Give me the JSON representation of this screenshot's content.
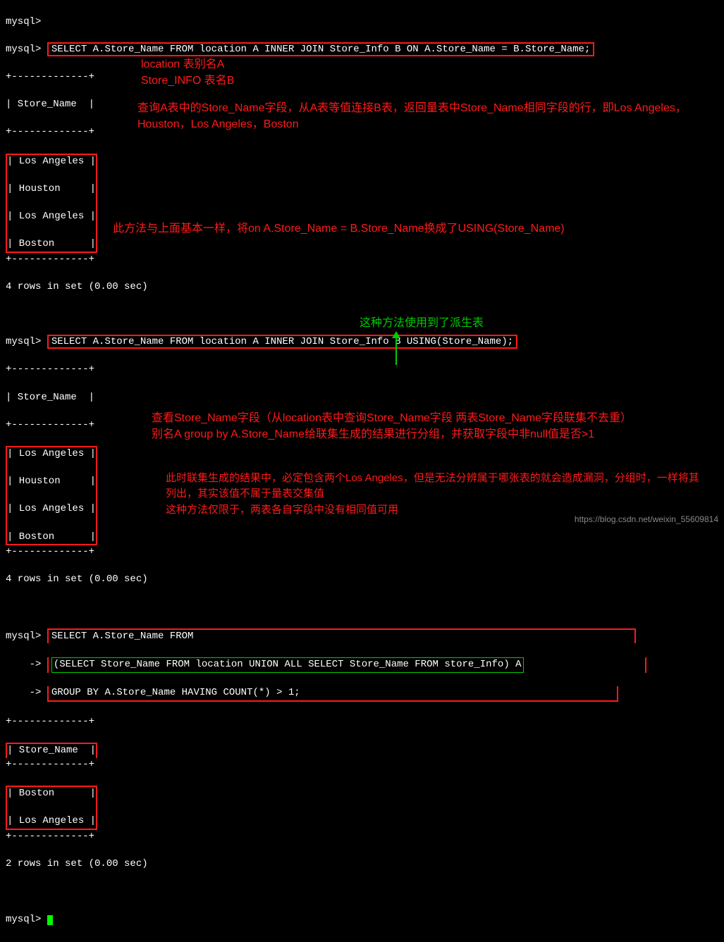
{
  "prompts": {
    "mysql": "mysql>",
    "cont": "    ->"
  },
  "queries": {
    "q1": "SELECT A.Store_Name FROM location A INNER JOIN Store_Info B ON A.Store_Name = B.Store_Name;",
    "q2": "SELECT A.Store_Name FROM location A INNER JOIN Store_Info B USING(Store_Name);",
    "q3a": "SELECT A.Store_Name FROM",
    "q3b": "(SELECT Store_Name FROM location UNION ALL SELECT Store_Name FROM store_Info) A",
    "q3c": "GROUP BY A.Store_Name HAVING COUNT(*) > 1;"
  },
  "table": {
    "sep": "+-------------+",
    "header": "| Store_Name  |",
    "sep2": "+-------------+",
    "rows1": [
      "| Los Angeles |",
      "| Houston     |",
      "| Los Angeles |",
      "| Boston      |"
    ],
    "rows3": [
      "| Boston      |",
      "| Los Angeles |"
    ],
    "footer4": "4 rows in set (0.00 sec)",
    "footer2": "2 rows in set (0.00 sec)"
  },
  "annotations": {
    "a1_line1": "location 表别名A",
    "a1_line2": "Store_INFO 表名B",
    "a2": "查询A表中的Store_Name字段，从A表等值连接B表，返回量表中Store_Name相同字段的行，即Los Angeles，Houston，Los Angeles，Boston",
    "a3": "此方法与上面基本一样，将on A.Store_Name = B.Store_Name换成了USING(Store_Name)",
    "green": "这种方法使用到了派生表",
    "a4": "查看Store_Name字段（从location表中查询Store_Name字段 两表Store_Name字段联集不去重）别名A group by A.Store_Name给联集生成的结果进行分组，并获取字段中非null值是否>1",
    "a5": "此时联集生成的结果中，必定包含两个Los Angeles，但是无法分辨属于哪张表的就会造成漏洞，分组时，一样将其列出，其实该值不属于量表交集值",
    "a6": "这种方法仅限于，两表各自字段中没有相同值可用"
  },
  "watermark": "https://blog.csdn.net/weixin_55609814"
}
